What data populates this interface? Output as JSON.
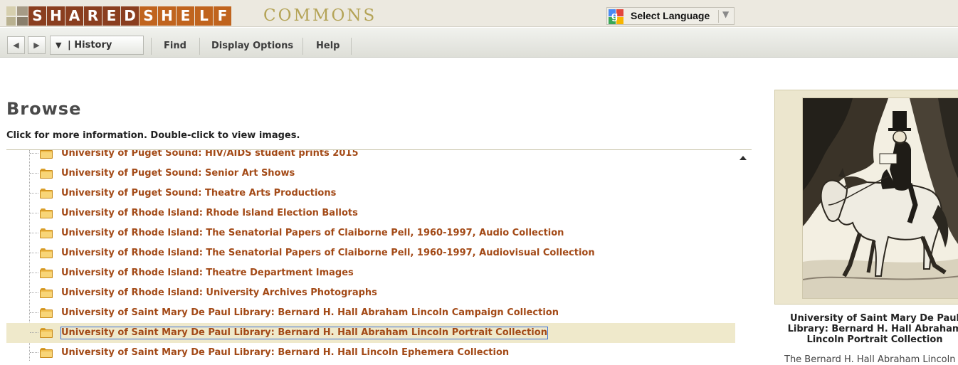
{
  "banner": {
    "logo_letters": [
      {
        "ch": "S",
        "color": "#8a3e1f"
      },
      {
        "ch": "H",
        "color": "#8a3e1f"
      },
      {
        "ch": "A",
        "color": "#8a3e1f"
      },
      {
        "ch": "R",
        "color": "#8a3e1f"
      },
      {
        "ch": "E",
        "color": "#8a3e1f"
      },
      {
        "ch": "D",
        "color": "#8a3e1f"
      },
      {
        "ch": "S",
        "color": "#c0641e"
      },
      {
        "ch": "H",
        "color": "#c0641e"
      },
      {
        "ch": "E",
        "color": "#c0641e"
      },
      {
        "ch": "L",
        "color": "#c0641e"
      },
      {
        "ch": "F",
        "color": "#c0641e"
      }
    ],
    "logo_suffix": "COMMONS",
    "language_select": {
      "label": "Select Language",
      "icon": "google-g-icon"
    }
  },
  "toolbar": {
    "back_icon": "back-arrow-icon",
    "forward_icon": "forward-arrow-icon",
    "history_label": "| History",
    "menu": [
      "Find",
      "Display Options",
      "Help"
    ]
  },
  "main": {
    "title": "Browse",
    "instructions": "Click for more information. Double-click to view images.",
    "tree_items": [
      {
        "label": "University of Puget Sound: HIV/AIDS student prints 2015",
        "selected": false
      },
      {
        "label": "University of Puget Sound: Senior Art Shows",
        "selected": false
      },
      {
        "label": "University of Puget Sound: Theatre Arts Productions",
        "selected": false
      },
      {
        "label": "University of Rhode Island: Rhode Island Election Ballots",
        "selected": false
      },
      {
        "label": "University of Rhode Island: The Senatorial Papers of Claiborne Pell, 1960-1997, Audio Collection",
        "selected": false
      },
      {
        "label": "University of Rhode Island: The Senatorial Papers of Claiborne Pell, 1960-1997, Audiovisual Collection",
        "selected": false
      },
      {
        "label": "University of Rhode Island: Theatre Department Images",
        "selected": false
      },
      {
        "label": "University of Rhode Island: University Archives Photographs",
        "selected": false
      },
      {
        "label": "University of Saint Mary De Paul Library: Bernard H. Hall Abraham Lincoln Campaign Collection",
        "selected": false
      },
      {
        "label": "University of Saint Mary De Paul Library: Bernard H. Hall Abraham Lincoln Portrait Collection",
        "selected": true
      },
      {
        "label": "University of Saint Mary De Paul Library: Bernard H. Hall Lincoln Ephemera Collection",
        "selected": false
      }
    ]
  },
  "preview": {
    "caption_lines": [
      "University of Saint Mary De Paul",
      "Library: Bernard H. Hall Abraham",
      "Lincoln Portrait Collection"
    ],
    "description": "The Bernard H. Hall Abraham Lincoln"
  }
}
